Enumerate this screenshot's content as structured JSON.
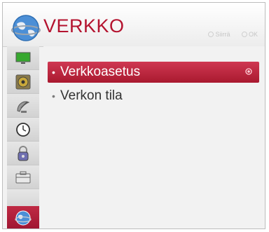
{
  "header": {
    "title": "VERKKO",
    "hint_move": "Siirrä",
    "hint_ok": "OK"
  },
  "sidebar": {
    "items": [
      {
        "icon": "picture-icon"
      },
      {
        "icon": "sound-icon"
      },
      {
        "icon": "channel-icon"
      },
      {
        "icon": "time-icon"
      },
      {
        "icon": "lock-icon"
      },
      {
        "icon": "option-icon"
      },
      {
        "icon": "network-icon",
        "active": true
      }
    ]
  },
  "menu": {
    "items": [
      {
        "label": "Verkkoasetus",
        "selected": true
      },
      {
        "label": "Verkon tila",
        "selected": false
      }
    ]
  },
  "colors": {
    "accent": "#b4132f",
    "selected_bg": "#c02a44"
  }
}
